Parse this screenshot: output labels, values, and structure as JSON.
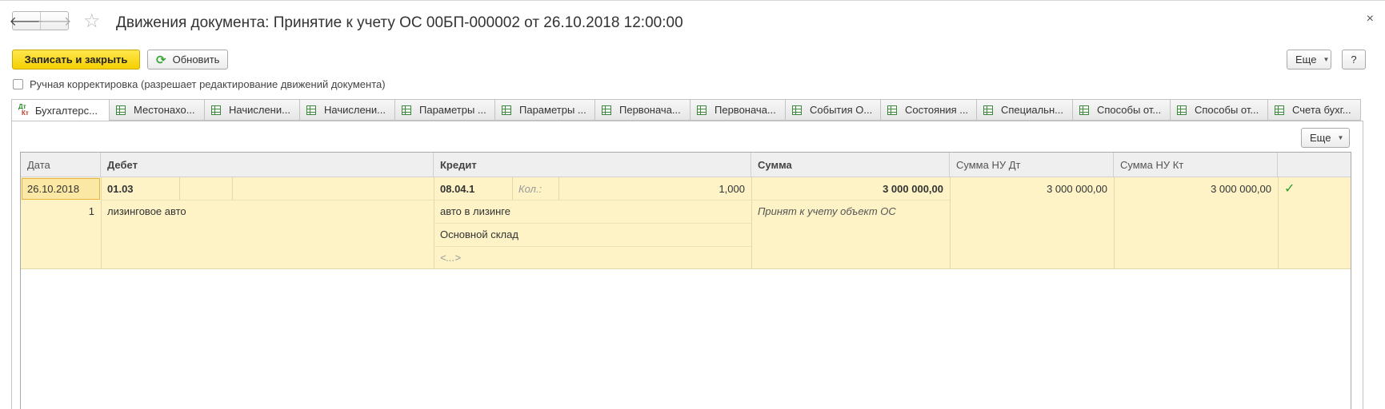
{
  "window": {
    "title": "Движения документа: Принятие к учету ОС 00БП-000002 от 26.10.2018 12:00:00",
    "close": "×"
  },
  "nav": {
    "back": "🡐",
    "forward": "🡒",
    "favorite": "☆"
  },
  "toolbar": {
    "save_close": "Записать и закрыть",
    "refresh": "Обновить",
    "more": "Еще",
    "help": "?"
  },
  "manual_edit": {
    "label": "Ручная корректировка (разрешает редактирование движений документа)",
    "checked": false
  },
  "tabs": [
    {
      "label": "Бухгалтерс...",
      "active": true,
      "icon": "dt-kt-icon"
    },
    {
      "label": "Местонахо...",
      "icon": "table-icon"
    },
    {
      "label": "Начислени...",
      "icon": "table-icon"
    },
    {
      "label": "Начислени...",
      "icon": "table-icon"
    },
    {
      "label": "Параметры ...",
      "icon": "table-icon"
    },
    {
      "label": "Параметры ...",
      "icon": "table-icon"
    },
    {
      "label": "Первонача...",
      "icon": "table-icon"
    },
    {
      "label": "Первонача...",
      "icon": "table-icon"
    },
    {
      "label": "События О...",
      "icon": "table-icon"
    },
    {
      "label": "Состояния ...",
      "icon": "table-icon"
    },
    {
      "label": "Специальн...",
      "icon": "table-icon"
    },
    {
      "label": "Способы от...",
      "icon": "table-icon"
    },
    {
      "label": "Способы от...",
      "icon": "table-icon"
    },
    {
      "label": "Счета бухг...",
      "icon": "table-icon"
    }
  ],
  "panel": {
    "more": "Еще"
  },
  "grid": {
    "columns": {
      "date": "Дата",
      "debit": "Дебет",
      "credit": "Кредит",
      "sum": "Сумма",
      "sum_nu_dt": "Сумма НУ Дт",
      "sum_nu_kt": "Сумма НУ Кт"
    },
    "row": {
      "date": "26.10.2018",
      "line_no": "1",
      "debit_account": "01.03",
      "debit_subconto1": "лизинговое авто",
      "credit_account": "08.04.1",
      "qty_label": "Кол.:",
      "qty_value": "1,000",
      "credit_subconto1": "авто в лизинге",
      "credit_subconto2": "Основной склад",
      "credit_subconto3": "<...>",
      "sum": "3 000 000,00",
      "content": "Принят к учету объект ОС",
      "sum_nu_dt": "3 000 000,00",
      "sum_nu_kt": "3 000 000,00",
      "active_mark": "✓"
    }
  }
}
